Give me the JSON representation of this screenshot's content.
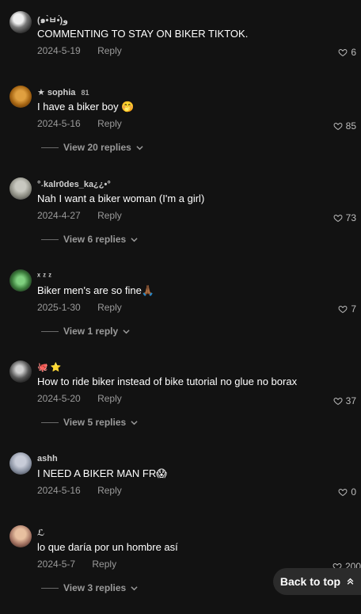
{
  "comments": [
    {
      "username": "(๑•̀ㅂ•́)و",
      "text": "COMMENTING TO STAY ON BIKER TIKTOK.",
      "date": "2024-5-19",
      "reply": "Reply",
      "likes": "6",
      "view_replies": ""
    },
    {
      "username": "★ sophia",
      "badge": "81",
      "text": "I have a biker boy 🤭",
      "date": "2024-5-16",
      "reply": "Reply",
      "likes": "85",
      "view_replies": "View 20 replies"
    },
    {
      "username": "°˖kalr0des_ka¿¿•°",
      "text": "Nah I want a biker woman (I'm a girl)",
      "date": "2024-4-27",
      "reply": "Reply",
      "likes": "73",
      "view_replies": "View 6 replies"
    },
    {
      "username": "ˣ ᶻ ᶻ",
      "text": "Biker men's are so fine🙏🏾",
      "date": "2025-1-30",
      "reply": "Reply",
      "likes": "7",
      "view_replies": "View 1 reply"
    },
    {
      "username": "🐙 ⭐",
      "text": "How to ride biker instead of bike tutorial no glue no borax",
      "date": "2024-5-20",
      "reply": "Reply",
      "likes": "37",
      "view_replies": "View 5 replies"
    },
    {
      "username": "ashh",
      "text": "I NEED A BIKER MAN FR😱",
      "date": "2024-5-16",
      "reply": "Reply",
      "likes": "0",
      "view_replies": ""
    },
    {
      "username": "ℒ",
      "text": "lo que daría por un hombre así",
      "date": "2024-5-7",
      "reply": "Reply",
      "likes": "200",
      "view_replies": "View 3 replies"
    }
  ],
  "back_to_top": "Back to top",
  "colors": {
    "background": "#121212",
    "muted": "#9a9a9a",
    "button": "#2b2b2b"
  },
  "icons": {
    "like": "heart-outline-icon",
    "expand": "chevron-down-icon",
    "top": "double-chevron-up-icon"
  }
}
